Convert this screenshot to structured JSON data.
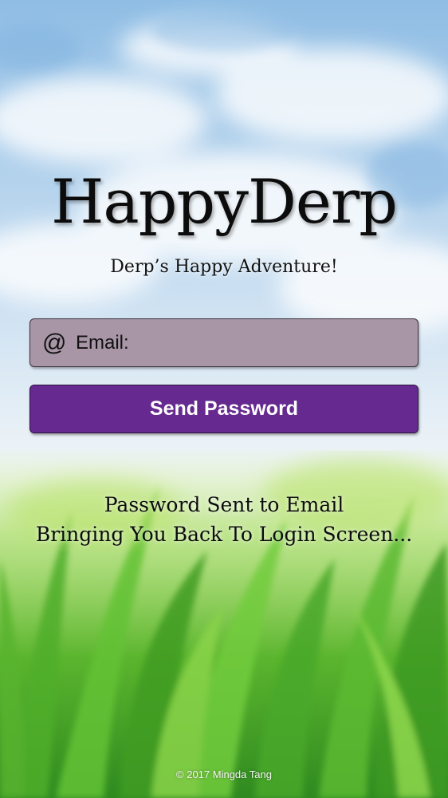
{
  "app": {
    "title": "HappyDerp",
    "subtitle": "Derp’s Happy Adventure!"
  },
  "form": {
    "email_icon": "@",
    "email_label": "Email:",
    "send_button_label": "Send Password"
  },
  "status": {
    "line1": "Password Sent to Email",
    "line2": "Bringing You Back To Login Screen..."
  },
  "footer": {
    "copyright": "© 2017 Mingda Tang"
  },
  "colors": {
    "email_field_bg": "#a896a7",
    "button_bg": "#65298f",
    "sky": "#cfe4f6",
    "grass": "#6cc43a"
  },
  "icons": {
    "email_icon": "at-sign-icon"
  }
}
